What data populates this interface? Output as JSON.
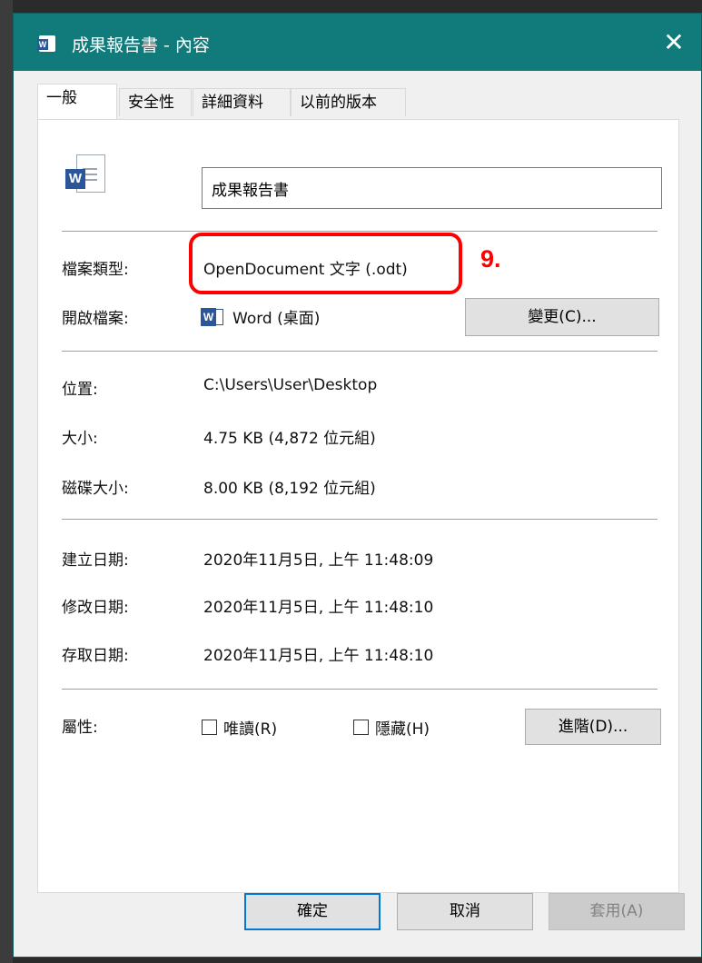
{
  "window": {
    "title": "成果報告書 - 內容",
    "close_glyph": "✕"
  },
  "tabs": [
    "一般",
    "安全性",
    "詳細資料",
    "以前的版本"
  ],
  "general": {
    "file_name": "成果報告書",
    "file_type_label": "檔案類型:",
    "file_type_value": "OpenDocument 文字 (.odt)",
    "annotation": "9.",
    "opens_with_label": "開啟檔案:",
    "opens_with_value": "Word (桌面)",
    "change_button": "變更(C)...",
    "location_label": "位置:",
    "location_value": "C:\\Users\\User\\Desktop",
    "size_label": "大小:",
    "size_value": "4.75 KB (4,872 位元組)",
    "disk_size_label": "磁碟大小:",
    "disk_size_value": "8.00 KB (8,192 位元組)",
    "created_label": "建立日期:",
    "created_value": "2020年11月5日, 上午 11:48:09",
    "modified_label": "修改日期:",
    "modified_value": "2020年11月5日, 上午 11:48:10",
    "accessed_label": "存取日期:",
    "accessed_value": "2020年11月5日, 上午 11:48:10",
    "attributes_label": "屬性:",
    "readonly_label": "唯讀(R)",
    "hidden_label": "隱藏(H)",
    "advanced_button": "進階(D)..."
  },
  "buttons": {
    "ok": "確定",
    "cancel": "取消",
    "apply": "套用(A)"
  },
  "colors": {
    "titlebar": "#117a7b",
    "highlight": "#ff0000",
    "word_blue": "#2b579a"
  }
}
